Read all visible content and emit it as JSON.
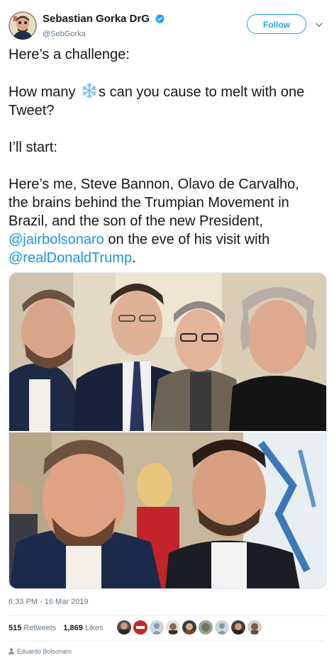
{
  "user": {
    "display_name": "Sebastian Gorka DrG",
    "handle": "@SebGorka",
    "verified_icon": "verified-badge-icon"
  },
  "follow_label": "Follow",
  "tweet": {
    "line1": "Here’s a challenge:",
    "line2_before": "How many ",
    "line2_emoji": "snowflake-icon",
    "line2_after": "s can you cause to melt with one Tweet?",
    "line3": "I’ll start:",
    "line4_before": "Here’s me, Steve Bannon, Olavo de Carvalho, the brains behind the Trumpian Movement in Brazil, and the son of the new President, ",
    "mention1": "@jairbolsonaro",
    "line4_middle": " on the eve of his visit with ",
    "mention2": "@realDonaldTrump",
    "line4_end": "."
  },
  "timestamp": "6:33 PM - 16 Mar 2019",
  "stats": {
    "retweets_count": "515",
    "retweets_label": "Retweets",
    "likes_count": "1,869",
    "likes_label": "Likes"
  },
  "footer": {
    "user": "Eduardo Bolsonaro"
  },
  "colors": {
    "accent": "#1da1f2",
    "mention": "#1b95e0",
    "secondary_text": "#657786"
  }
}
